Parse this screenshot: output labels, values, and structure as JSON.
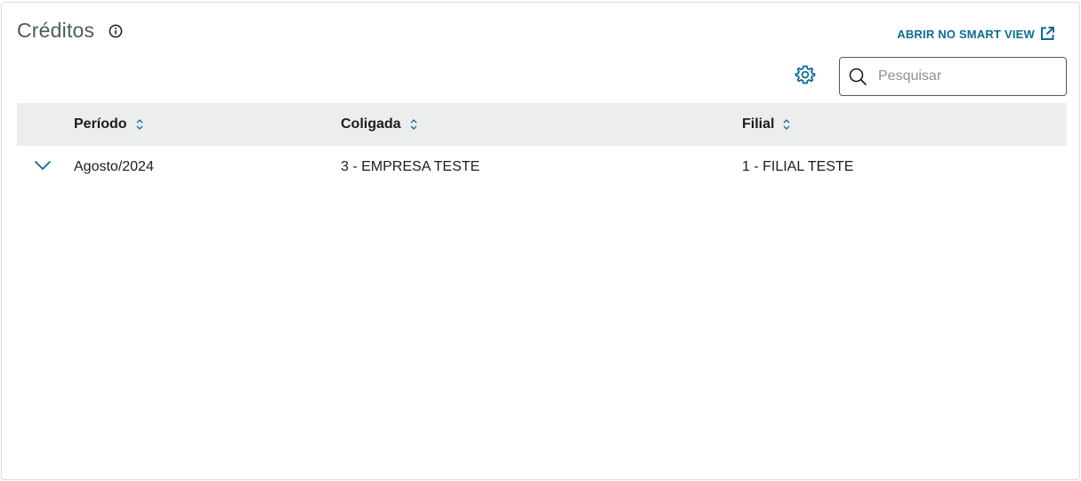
{
  "header": {
    "title": "Créditos",
    "info_icon": "info-icon",
    "smart_view_label": "ABRIR NO SMART VIEW",
    "smart_view_icon": "external-link-icon"
  },
  "toolbar": {
    "settings_icon": "gear-icon",
    "search": {
      "placeholder": "Pesquisar",
      "value": "",
      "icon": "search-icon"
    }
  },
  "table": {
    "columns": [
      {
        "label": "Período",
        "sortable": true
      },
      {
        "label": "Coligada",
        "sortable": true
      },
      {
        "label": "Filial",
        "sortable": true
      }
    ],
    "rows": [
      {
        "periodo": "Agosto/2024",
        "coligada": "3 - EMPRESA TESTE",
        "filial": "1 - FILIAL TESTE",
        "expand_icon": "chevron-down-icon"
      }
    ]
  },
  "colors": {
    "accent": "#0c6c94",
    "title": "#4a5c60",
    "header_bg": "#eceeee",
    "border": "#dadcde"
  }
}
